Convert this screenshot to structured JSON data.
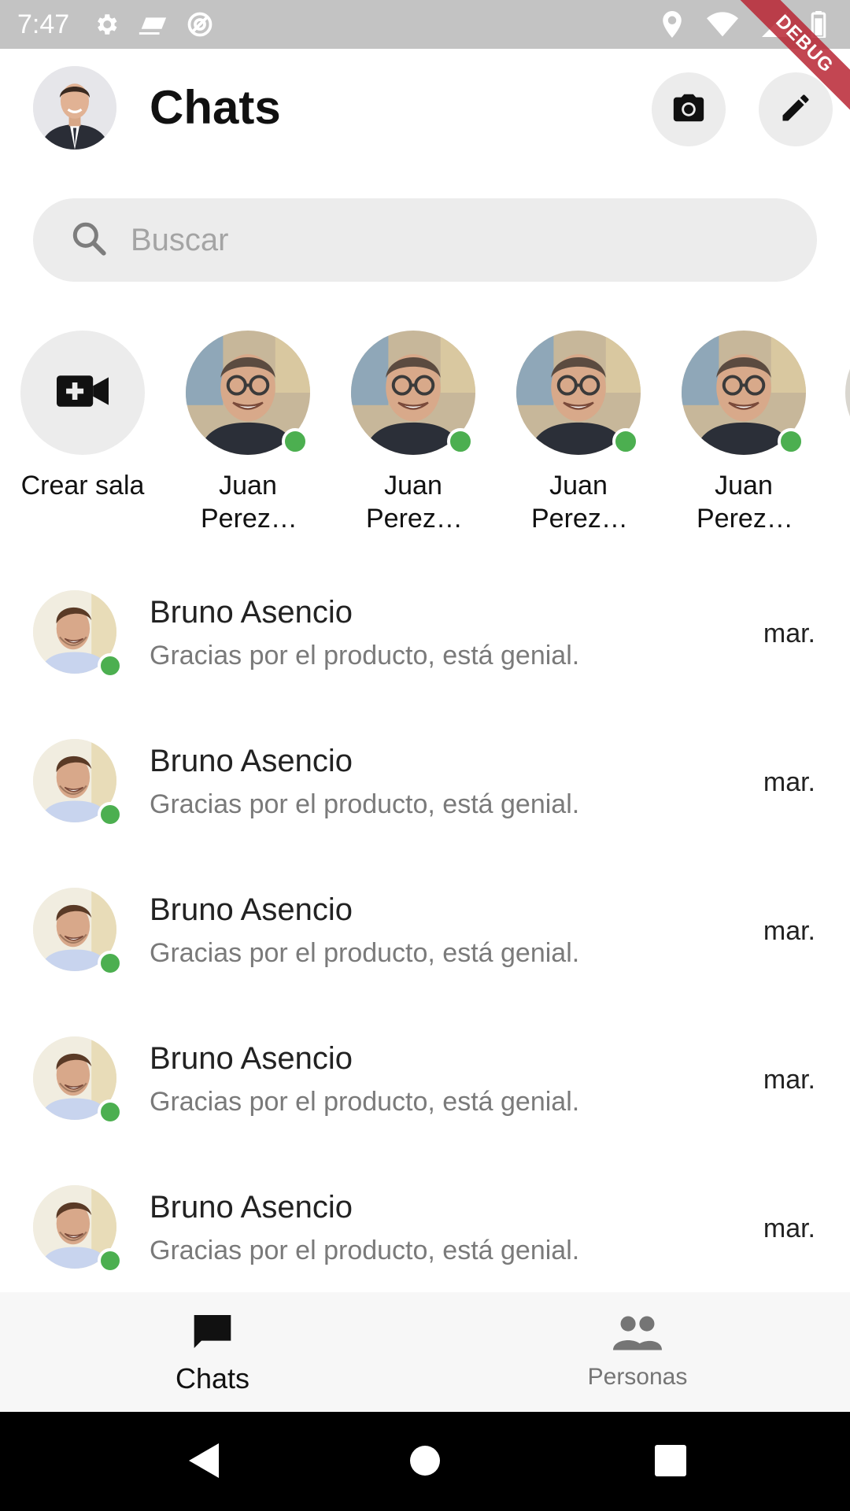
{
  "status_bar": {
    "time": "7:47",
    "left_icons": [
      "settings-icon",
      "cast-icon",
      "do-not-disturb-icon"
    ],
    "right_icons": [
      "location-icon",
      "wifi-icon",
      "signal-icon",
      "battery-icon"
    ]
  },
  "debug_banner": "DEBUG",
  "header": {
    "title": "Chats",
    "camera_icon": "camera-icon",
    "edit_icon": "edit-icon"
  },
  "search": {
    "placeholder": "Buscar"
  },
  "stories": {
    "create_label": "Crear sala",
    "people": [
      {
        "name": "Juan Perez…",
        "online": true
      },
      {
        "name": "Juan Perez…",
        "online": true
      },
      {
        "name": "Juan Perez…",
        "online": true
      },
      {
        "name": "Juan Perez…",
        "online": true
      }
    ]
  },
  "chats": [
    {
      "name": "Bruno Asencio",
      "preview": "Gracias por el producto, está genial.",
      "time": "mar.",
      "online": true
    },
    {
      "name": "Bruno Asencio",
      "preview": "Gracias por el producto, está genial.",
      "time": "mar.",
      "online": true
    },
    {
      "name": "Bruno Asencio",
      "preview": "Gracias por el producto, está genial.",
      "time": "mar.",
      "online": true
    },
    {
      "name": "Bruno Asencio",
      "preview": "Gracias por el producto, está genial.",
      "time": "mar.",
      "online": true
    },
    {
      "name": "Bruno Asencio",
      "preview": "Gracias por el producto, está genial.",
      "time": "mar.",
      "online": true
    }
  ],
  "bottom_nav": {
    "chats_label": "Chats",
    "people_label": "Personas",
    "active": "Chats"
  },
  "colors": {
    "online": "#4caf50",
    "status_bar": "#c3c3c3",
    "pill_background": "#ececec"
  }
}
